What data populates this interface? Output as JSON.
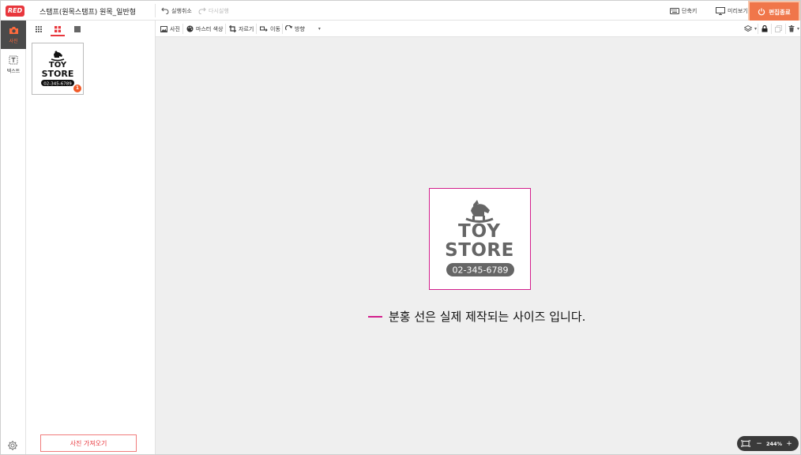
{
  "app": {
    "logo": "RED",
    "doc_title": "스탬프(원목스탬프) 원목_일반형"
  },
  "toolbar": {
    "undo_label": "실행취소",
    "redo_label": "다시실행",
    "shortcut_label": "단축키",
    "preview_label": "미리보기",
    "finish_label": "편집종료"
  },
  "rail": {
    "photo_label": "사진",
    "text_label": "텍스트"
  },
  "panel": {
    "thumb_badge": "1",
    "import_label": "사진 가져오기"
  },
  "edit_tools": {
    "photo": "사진",
    "master_color": "마스터 색상",
    "crop": "자르기",
    "move": "이동",
    "direction": "방향"
  },
  "stamp": {
    "line1": "TOY",
    "line2": "STORE",
    "phone": "02-345-6789"
  },
  "canvas": {
    "guide_text": "분홍 선은 실제 제작되는 사이즈 입니다."
  },
  "zoom": {
    "value": "244%",
    "minus": "−",
    "plus": "+"
  },
  "colors": {
    "accent": "#f0764a",
    "brand_red": "#e8373d",
    "guide_pink": "#d21e8c"
  }
}
